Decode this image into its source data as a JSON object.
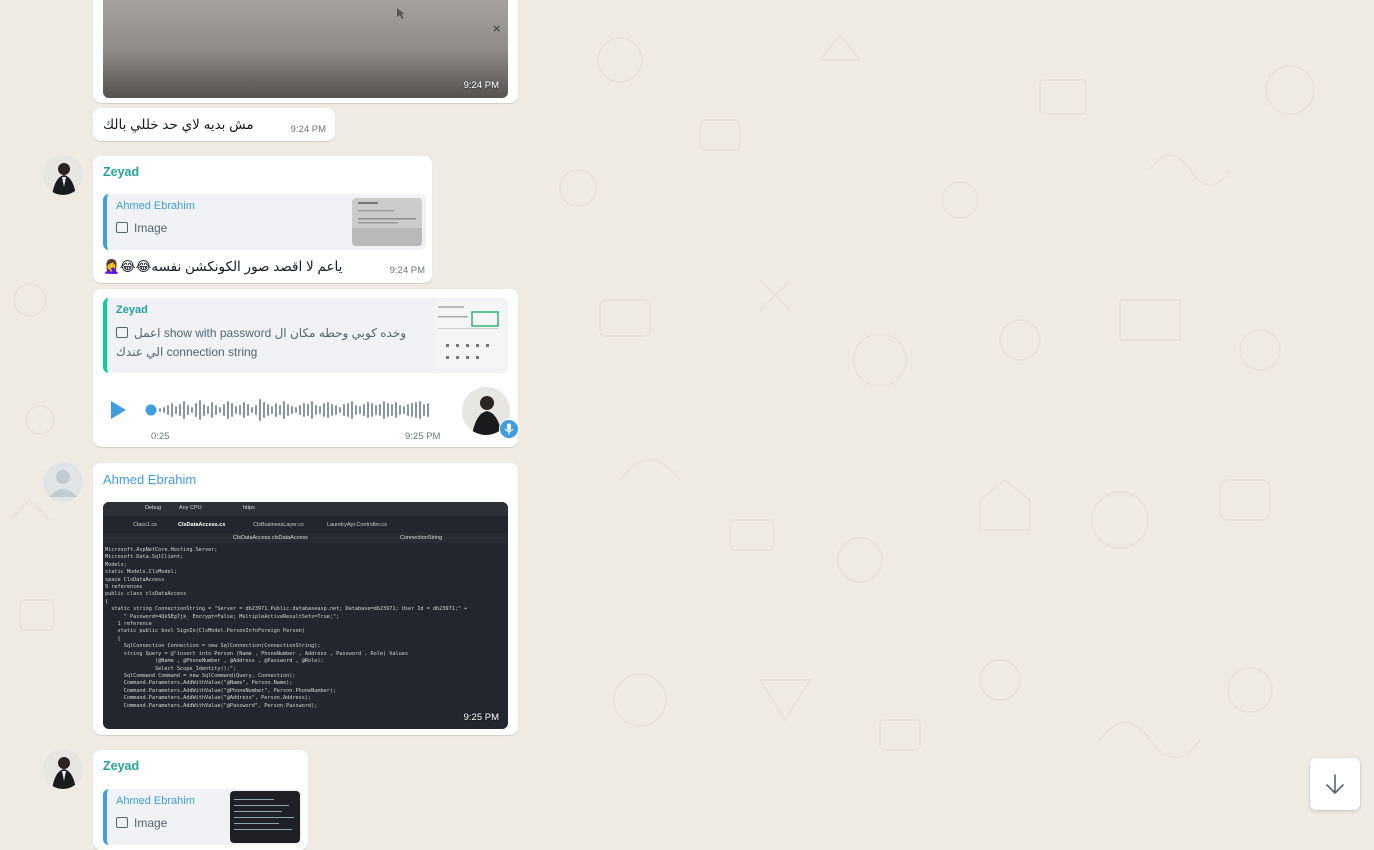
{
  "colors": {
    "chat_background": "#efeae2",
    "bubble": "#ffffff",
    "sender_zeyad": "#25a0a0",
    "sender_ahmed": "#3f9ee0",
    "voice_accent": "#3f9ee0"
  },
  "messages": {
    "m1_image": {
      "time": "9:24 PM"
    },
    "m2_text": {
      "text": "مش بديه لاي حد خللي بالك",
      "time": "9:24 PM"
    },
    "m3_reply": {
      "sender": "Zeyad",
      "quote_sender": "Ahmed Ebrahim",
      "quote_label": "Image",
      "text": "ياعم لا اقصد صور الكونكشن نفسه😂😂🤦‍♀️",
      "time": "9:24 PM"
    },
    "m4_voice": {
      "quote_sender": "Zeyad",
      "quote_line1": "وخده كوبي وحطه مكان ال show with password اعمل",
      "quote_line2": "الي عندك connection string",
      "duration": "0:25",
      "time": "9:25 PM"
    },
    "m5_image": {
      "sender": "Ahmed Ebrahim",
      "time": "9:25 PM",
      "screen_tabs": [
        "Class1.cs",
        "ClsDataAccess.cs",
        "ClsBusinessLayer.cs",
        "LaundryApi.Controller.cs"
      ],
      "screen_toolbar": [
        "Debug",
        "Any CPU",
        "https"
      ],
      "screen_breadcrumb": [
        "ClsDataAccess.clsDataAccess",
        "ConnectionString"
      ],
      "screen_code": [
        "Microsoft.AspNetCore.Hosting.Server;",
        "Microsoft.Data.SqlClient;",
        "Models;",
        "static Models.ClsModel;",
        "space ClsDataAccess",
        "",
        "9 references",
        "public class clsDataAccess",
        "{",
        "  static string ConnectionString = \"Server = db23971.Public.databaseasp.net; Database=db23971; User Id = db23971;\" +",
        "      \" Password=4QkSEg7jk_ Encrypt=False; MultipleActiveResultSets=True;\";",
        "",
        "    1 reference",
        "    static public bool SignIn(ClsModel.PersonInfoForeign Person)",
        "    {",
        "      SqlConnection Connection = new SqlConnection(ConnectionString);",
        "      string Query = @\"insert into Person (Name , PhoneNumber , Address , Password , Role) Values",
        "                (@Name , @PhoneNumber , @Address , @Password , @Role);",
        "                Select Scope_Identity();\";",
        "      SqlCommand Command = new SqlCommand(Query, Connection);",
        "",
        "      Command.Parameters.AddWithValue(\"@Name\", Person.Name);",
        "      Command.Parameters.AddWithValue(\"@PhoneNumber\", Person.PhoneNumber);",
        "      Command.Parameters.AddWithValue(\"@Address\", Person.Address);",
        "      Command.Parameters.AddWithValue(\"@Password\", Person.Password);"
      ]
    },
    "m6_reply": {
      "sender": "Zeyad",
      "quote_sender": "Ahmed Ebrahim",
      "quote_label": "Image"
    }
  },
  "icons": {
    "scroll_down": "arrow-down-icon",
    "play": "play-icon",
    "mic": "mic-icon",
    "image": "image-icon"
  }
}
